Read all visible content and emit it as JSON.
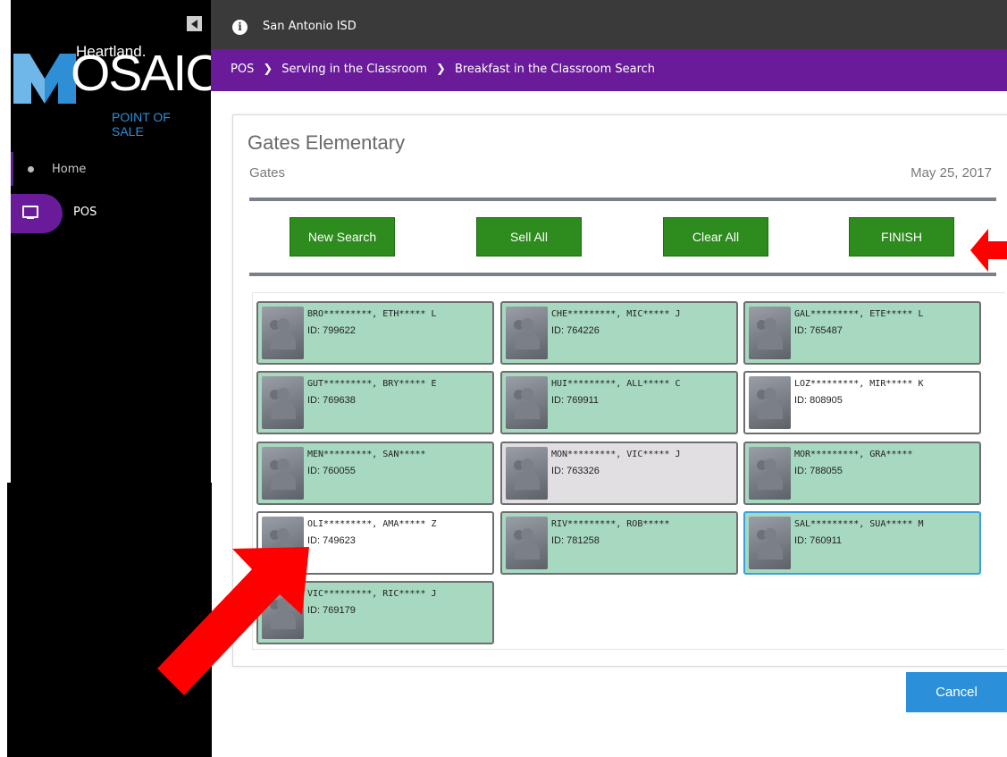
{
  "sidebar": {
    "logo": {
      "brand": "Heartland.",
      "product_initial": "M",
      "product_rest": "OSAIC",
      "tagline": "POINT OF SALE"
    },
    "nav": [
      {
        "label": "Home",
        "icon": "circle-icon"
      },
      {
        "label": "POS",
        "icon": "monitor-icon",
        "active": true
      }
    ]
  },
  "topbar": {
    "title": "San Antonio ISD",
    "icon": "info-icon"
  },
  "breadcrumb": [
    "POS",
    "Serving in the Classroom",
    "Breakfast in the Classroom Search"
  ],
  "header": {
    "school": "Gates Elementary",
    "site": "Gates",
    "date": "May 25, 2017"
  },
  "actions": {
    "new_search": "New Search",
    "sell_all": "Sell All",
    "clear_all": "Clear All",
    "finish": "FINISH"
  },
  "students": [
    {
      "name": "BRO*********, ETH***** L",
      "id": "ID: 799622",
      "state": "green"
    },
    {
      "name": "CHE*********, MIC***** J",
      "id": "ID: 764226",
      "state": "green"
    },
    {
      "name": "GAL*********, ETE***** L",
      "id": "ID: 765487",
      "state": "green"
    },
    {
      "name": "GUT*********, BRY***** E",
      "id": "ID: 769638",
      "state": "green"
    },
    {
      "name": "HUI*********, ALL***** C",
      "id": "ID: 769911",
      "state": "green"
    },
    {
      "name": "LOZ*********, MIR***** K",
      "id": "ID: 808905",
      "state": "white"
    },
    {
      "name": "MEN*********, SAN*****",
      "id": "ID: 760055",
      "state": "green"
    },
    {
      "name": "MON*********, VIC***** J",
      "id": "ID: 763326",
      "state": "gray"
    },
    {
      "name": "MOR*********, GRA*****",
      "id": "ID: 788055",
      "state": "green"
    },
    {
      "name": "OLI*********, AMA***** Z",
      "id": "ID: 749623",
      "state": "white"
    },
    {
      "name": "RIV*********, ROB*****",
      "id": "ID: 781258",
      "state": "green"
    },
    {
      "name": "SAL*********, SUA***** M",
      "id": "ID: 760911",
      "state": "selected"
    },
    {
      "name": "VIC*********, RIC***** J",
      "id": "ID: 769179",
      "state": "green"
    }
  ],
  "footer": {
    "cancel": "Cancel"
  },
  "colors": {
    "purple": "#6a1b9a",
    "green_button": "#2e8b1e",
    "card_green": "#a7d8c0",
    "cancel_blue": "#2b90d9",
    "arrow_red": "#ff0000"
  }
}
